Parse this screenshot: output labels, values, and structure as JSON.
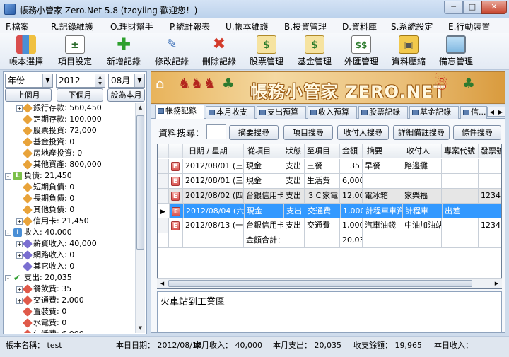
{
  "window": {
    "title": "帳務小管家 Zero.Net 5.8 (tzoyiing 歡迎您！)",
    "min_label": "─",
    "max_label": "□",
    "close_label": "✕"
  },
  "menu": [
    "F.檔案",
    "R.記錄維護",
    "O.理財幫手",
    "P.統計報表",
    "U.帳本維護",
    "B.投資管理",
    "D.資料庫",
    "S.系統設定",
    "E.行動裝置"
  ],
  "toolbar": [
    {
      "label": "帳本選擇",
      "icon": "books-icon"
    },
    {
      "label": "項目設定",
      "icon": "ledger-icon"
    },
    {
      "label": "新增記錄",
      "icon": "add-icon"
    },
    {
      "label": "修改記錄",
      "icon": "edit-icon"
    },
    {
      "label": "刪除記錄",
      "icon": "delete-icon"
    },
    {
      "label": "股票管理",
      "icon": "stock-icon"
    },
    {
      "label": "基金管理",
      "icon": "fund-icon"
    },
    {
      "label": "外匯管理",
      "icon": "forex-icon"
    },
    {
      "label": "資料壓縮",
      "icon": "compress-icon"
    },
    {
      "label": "備忘管理",
      "icon": "monitor-icon"
    }
  ],
  "left": {
    "period_select": "年份",
    "year_value": "2012",
    "month_select": "08月",
    "prev_month": "上個月",
    "next_month": "下個月",
    "set_current_month": "設為本月"
  },
  "tree": [
    {
      "indent": 2,
      "toggle": "+",
      "icon": "tag",
      "color": "#e8a33a",
      "text": "銀行存款: 560,450"
    },
    {
      "indent": 2,
      "toggle": "",
      "icon": "tag",
      "color": "#e8a33a",
      "text": "定期存款: 100,000"
    },
    {
      "indent": 2,
      "toggle": "",
      "icon": "tag",
      "color": "#e8a33a",
      "text": "股票投資: 72,000"
    },
    {
      "indent": 2,
      "toggle": "",
      "icon": "tag",
      "color": "#e8a33a",
      "text": "基金投資: 0"
    },
    {
      "indent": 2,
      "toggle": "",
      "icon": "tag",
      "color": "#e8a33a",
      "text": "房地產投資: 0"
    },
    {
      "indent": 2,
      "toggle": "",
      "icon": "tag",
      "color": "#e8a33a",
      "text": "其他資產: 800,000"
    },
    {
      "indent": 1,
      "toggle": "-",
      "icon": "box",
      "color": "#7cc04a",
      "box_label": "L",
      "text": "負債: 21,450"
    },
    {
      "indent": 2,
      "toggle": "",
      "icon": "tag",
      "color": "#e8a33a",
      "text": "短期負債: 0"
    },
    {
      "indent": 2,
      "toggle": "",
      "icon": "tag",
      "color": "#e8a33a",
      "text": "長期負債: 0"
    },
    {
      "indent": 2,
      "toggle": "",
      "icon": "tag",
      "color": "#e8a33a",
      "text": "其他負債: 0"
    },
    {
      "indent": 2,
      "toggle": "+",
      "icon": "tag",
      "color": "#e8a33a",
      "text": "信用卡: 21,450"
    },
    {
      "indent": 1,
      "toggle": "-",
      "icon": "box",
      "color": "#4a8fd6",
      "box_label": "I",
      "text": "收入: 40,000"
    },
    {
      "indent": 2,
      "toggle": "+",
      "icon": "tag",
      "color": "#7a6fd1",
      "text": "薪資收入: 40,000"
    },
    {
      "indent": 2,
      "toggle": "+",
      "icon": "tag",
      "color": "#7a6fd1",
      "text": "網路收入: 0"
    },
    {
      "indent": 2,
      "toggle": "",
      "icon": "tag",
      "color": "#7a6fd1",
      "text": "其它收入: 0"
    },
    {
      "indent": 1,
      "toggle": "-",
      "icon": "check",
      "color": "#2e9e2e",
      "text": "支出: 20,035"
    },
    {
      "indent": 2,
      "toggle": "+",
      "icon": "tag",
      "color": "#e05a4a",
      "text": "餐飲費: 35"
    },
    {
      "indent": 2,
      "toggle": "+",
      "icon": "tag",
      "color": "#e05a4a",
      "text": "交通費: 2,000"
    },
    {
      "indent": 2,
      "toggle": "",
      "icon": "tag",
      "color": "#e05a4a",
      "text": "置裝費: 0"
    },
    {
      "indent": 2,
      "toggle": "",
      "icon": "tag",
      "color": "#e05a4a",
      "text": "水電費: 0"
    },
    {
      "indent": 2,
      "toggle": "",
      "icon": "tag",
      "color": "#e05a4a",
      "text": "生活費: 6,000"
    }
  ],
  "banner": {
    "title": "帳務小管家 ZERO.NET"
  },
  "tabs": [
    "帳務記錄",
    "本月收支",
    "支出預算",
    "收入預算",
    "股票記錄",
    "基金記錄",
    "信..."
  ],
  "search": {
    "label": "資料搜尋：",
    "buttons": [
      "摘要搜尋",
      "項目搜尋",
      "收付人搜尋",
      "詳細備註搜尋",
      "條件搜尋"
    ]
  },
  "grid": {
    "columns": [
      "",
      "",
      "日期 / 星期",
      "從項目",
      "狀態",
      "至項目",
      "金額",
      "摘要",
      "收付人",
      "專案代號",
      "發票號"
    ],
    "rows": [
      {
        "date": "2012/08/01 (三)",
        "from": "現金",
        "status": "支出",
        "to": "三餐",
        "amount": "35",
        "memo": "早餐",
        "payee": "路邊攤",
        "project": "",
        "invoice": "",
        "style": ""
      },
      {
        "date": "2012/08/01 (三)",
        "from": "現金",
        "status": "支出",
        "to": "生活費",
        "amount": "6,000",
        "memo": "",
        "payee": "",
        "project": "",
        "invoice": "",
        "style": ""
      },
      {
        "date": "2012/08/02 (四)",
        "from": "台銀信用卡",
        "status": "支出",
        "to": "３Ｃ家電",
        "amount": "12,000",
        "memo": "電冰箱",
        "payee": "家樂福",
        "project": "",
        "invoice": "1234567",
        "style": "gray"
      },
      {
        "date": "2012/08/04 (六)",
        "from": "現金",
        "status": "支出",
        "to": "交通費",
        "amount": "1,000",
        "memo": "計程車車資",
        "payee": "計程車",
        "project": "出差",
        "invoice": "",
        "style": "sel"
      },
      {
        "date": "2012/08/13 (一)",
        "from": "台銀信用卡",
        "status": "支出",
        "to": "交通費",
        "amount": "1,000",
        "memo": "汽車油錢",
        "payee": "中油加油站",
        "project": "",
        "invoice": "1234567",
        "style": ""
      }
    ],
    "total_label": "金額合計：",
    "total_value": "20,035",
    "edit_badge": "E",
    "current_row_marker": "▶"
  },
  "memo_text": "火車站到工業區",
  "status": {
    "book_name": "帳本名稱： test",
    "date": "本日日期： 2012/08/18",
    "month_income": "本月收入： 40,000",
    "month_expense": "本月支出： 20,035",
    "balance": "收支餘額： 19,965",
    "today_income": "本日收入："
  }
}
